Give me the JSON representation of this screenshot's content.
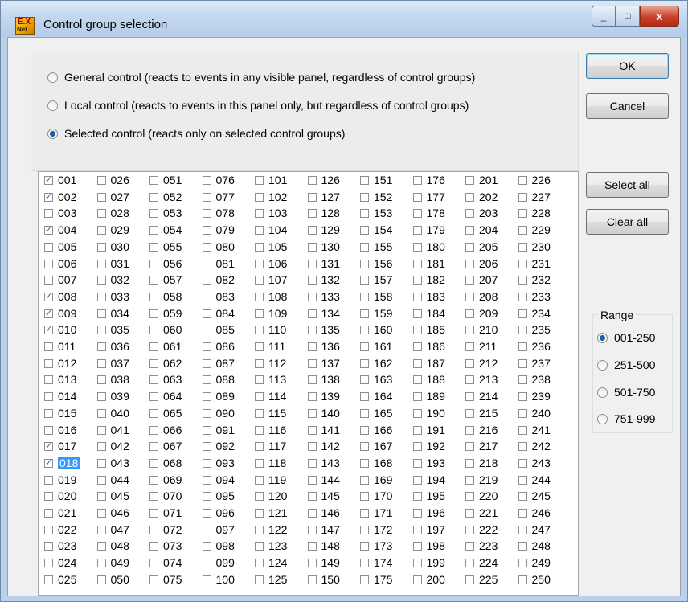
{
  "window": {
    "title": "Control group selection",
    "close_label": "x",
    "min_label": "_",
    "max_label": "□"
  },
  "app_icon": {
    "top": "E.X",
    "bottom": "Net"
  },
  "modes": [
    {
      "label": "General control (reacts to events in any visible panel, regardless of  control groups)",
      "selected": false
    },
    {
      "label": "Local control (reacts to events in this panel only, but regardless of control groups)",
      "selected": false
    },
    {
      "label": "Selected control (reacts only on selected control groups)",
      "selected": true
    }
  ],
  "groups": {
    "rows": 25,
    "cols": 10,
    "first": 1,
    "checked": [
      "001",
      "002",
      "004",
      "008",
      "009",
      "010",
      "017",
      "018"
    ],
    "focused": "018"
  },
  "buttons": {
    "ok": "OK",
    "cancel": "Cancel",
    "select_all": "Select all",
    "clear_all": "Clear all"
  },
  "range": {
    "title": "Range",
    "options": [
      {
        "label": "001-250",
        "selected": true
      },
      {
        "label": "251-500",
        "selected": false
      },
      {
        "label": "501-750",
        "selected": false
      },
      {
        "label": "751-999",
        "selected": false
      }
    ]
  },
  "colors": {
    "check": "#2a5a9a",
    "radio_dot": "#1c5ca8",
    "selection": "#3399ff"
  }
}
